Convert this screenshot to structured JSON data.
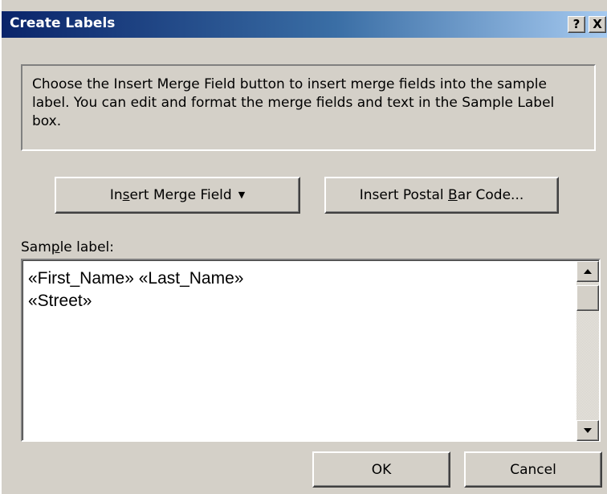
{
  "window": {
    "title": "Create Labels",
    "help_label": "?",
    "close_label": "X"
  },
  "instructions": "Choose the Insert Merge Field button to insert merge fields into the sample label.  You can edit and format the merge fields and text in the Sample Label box.",
  "buttons": {
    "insert_merge_field": {
      "pre": "In",
      "accel": "s",
      "post": "ert Merge Field",
      "arrow": "▼"
    },
    "insert_postal_bar_code": {
      "pre": "Insert Postal ",
      "accel": "B",
      "post": "ar Code..."
    },
    "ok": "OK",
    "cancel": "Cancel"
  },
  "sample_label": {
    "caption": {
      "pre": "Sam",
      "accel": "p",
      "post": "le label:"
    },
    "lines": [
      "«First_Name» «Last_Name»",
      "«Street»"
    ]
  },
  "colors": {
    "title_gradient_start": "#0a246a",
    "title_gradient_end": "#a6caf0",
    "dialog_face": "#d4d0c8"
  }
}
